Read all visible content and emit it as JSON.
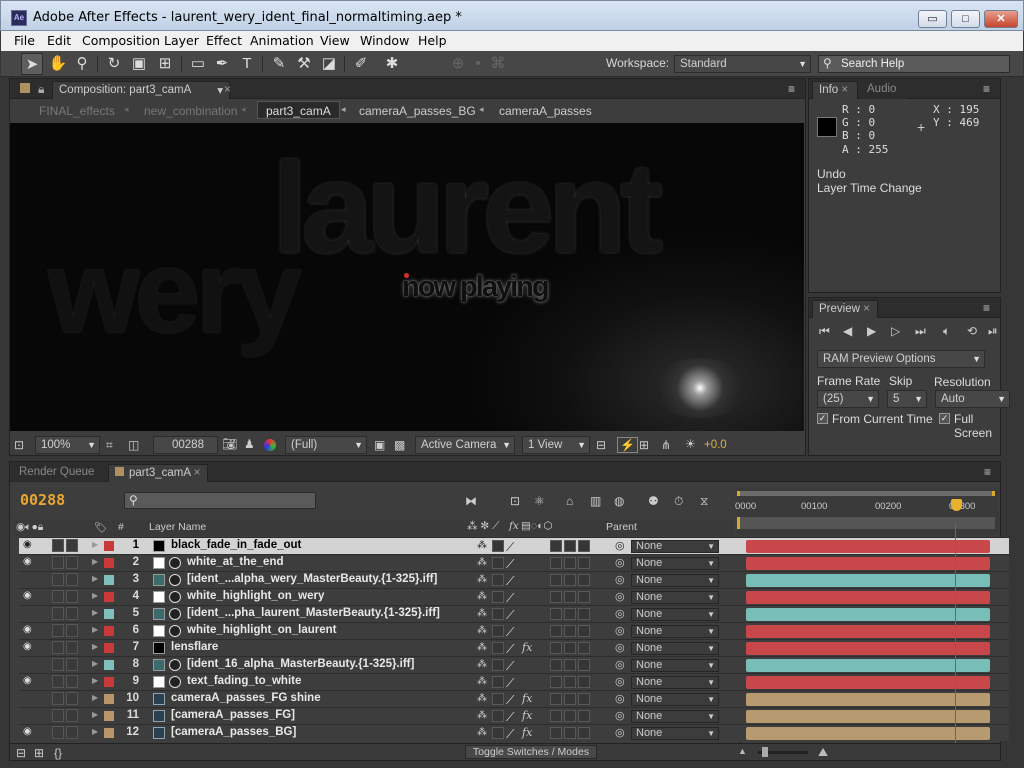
{
  "window": {
    "title": "Adobe After Effects - laurent_wery_ident_final_normaltiming.aep *",
    "app_icon": "Ae",
    "min": "▭",
    "max": "□",
    "close": "✕"
  },
  "menu": [
    "File",
    "Edit",
    "Composition",
    "Layer",
    "Effect",
    "Animation",
    "View",
    "Window",
    "Help"
  ],
  "toolbar": {
    "workspace_label": "Workspace:",
    "workspace_value": "Standard",
    "search_placeholder": "Search Help"
  },
  "comp_panel": {
    "tab_label": "Composition: part3_camA",
    "breadcrumbs": [
      "FINAL_effects",
      "new_combination",
      "part3_camA",
      "cameraA_passes_BG",
      "cameraA_passes"
    ],
    "active_crumb": 2
  },
  "viewer": {
    "word1": "laurent",
    "word2": "wery",
    "word3": "now playing"
  },
  "viewer_footer": {
    "zoom": "100%",
    "timecode": "00288",
    "resolution": "(Full)",
    "camera": "Active Camera",
    "views": "1 View",
    "exposure": "+0.0"
  },
  "info": {
    "tab_info": "Info",
    "tab_audio": "Audio",
    "r": "R : 0",
    "g": "G : 0",
    "b": "B : 0",
    "a": "A : 255",
    "x": "X : 195",
    "y": "Y : 469",
    "undo_label": "Undo",
    "undo_value": "Layer Time Change"
  },
  "preview": {
    "tab": "Preview",
    "ram_options": "RAM Preview Options",
    "frame_rate_label": "Frame Rate",
    "skip_label": "Skip",
    "resolution_label": "Resolution",
    "frame_rate": "(25)",
    "skip": "5",
    "resolution": "Auto",
    "from_current": "From Current Time",
    "full_screen": "Full Screen"
  },
  "timeline": {
    "render_queue_tab": "Render Queue",
    "comp_tab": "part3_camA",
    "timecode": "00288",
    "col_hash": "#",
    "col_layer_name": "Layer Name",
    "col_parent": "Parent",
    "ruler": [
      "0000",
      "00100",
      "00200",
      "00300"
    ],
    "toggle": "Toggle Switches / Modes",
    "fx": "fx",
    "parent_none": "None"
  },
  "layers": [
    {
      "num": "1",
      "name": "black_fade_in_fade_out",
      "label_color": "#c83a3a",
      "type": "solid-black",
      "track_color": "#c8474b",
      "selected": true,
      "eye": true
    },
    {
      "num": "2",
      "name": "white_at_the_end",
      "label_color": "#c83a3a",
      "type": "solid-white",
      "track_color": "#c8474b",
      "selected": false,
      "eye": true
    },
    {
      "num": "3",
      "name": "[ident_...alpha_wery_MasterBeauty.{1-325}.iff]",
      "label_color": "#7fc0bd",
      "type": "footage",
      "track_color": "#79bdb8",
      "selected": false,
      "eye": false
    },
    {
      "num": "4",
      "name": "white_highlight_on_wery",
      "label_color": "#c83a3a",
      "type": "solid-white",
      "track_color": "#c8474b",
      "selected": false,
      "eye": true
    },
    {
      "num": "5",
      "name": "[ident_...pha_laurent_MasterBeauty.{1-325}.iff]",
      "label_color": "#7fc0bd",
      "type": "footage",
      "track_color": "#79bdb8",
      "selected": false,
      "eye": false
    },
    {
      "num": "6",
      "name": "white_highlight_on_laurent",
      "label_color": "#c83a3a",
      "type": "solid-white",
      "track_color": "#c8474b",
      "selected": false,
      "eye": true
    },
    {
      "num": "7",
      "name": "lensflare",
      "label_color": "#c83a3a",
      "type": "solid-black",
      "track_color": "#c8474b",
      "selected": false,
      "eye": true,
      "fx": true
    },
    {
      "num": "8",
      "name": "[ident_16_alpha_MasterBeauty.{1-325}.iff]",
      "label_color": "#7fc0bd",
      "type": "footage",
      "track_color": "#79bdb8",
      "selected": false,
      "eye": false
    },
    {
      "num": "9",
      "name": "text_fading_to_white",
      "label_color": "#c83a3a",
      "type": "solid-white",
      "track_color": "#c8474b",
      "selected": false,
      "eye": true
    },
    {
      "num": "10",
      "name": "cameraA_passes_FG shine",
      "label_color": "#b8956a",
      "type": "comp",
      "track_color": "#b89a70",
      "selected": false,
      "eye": false,
      "fx": true
    },
    {
      "num": "11",
      "name": "[cameraA_passes_FG]",
      "label_color": "#b8956a",
      "type": "comp",
      "track_color": "#b89a70",
      "selected": false,
      "eye": false,
      "fx": true
    },
    {
      "num": "12",
      "name": "[cameraA_passes_BG]",
      "label_color": "#b8956a",
      "type": "comp",
      "track_color": "#b89a70",
      "selected": false,
      "eye": true,
      "fx": true
    }
  ]
}
